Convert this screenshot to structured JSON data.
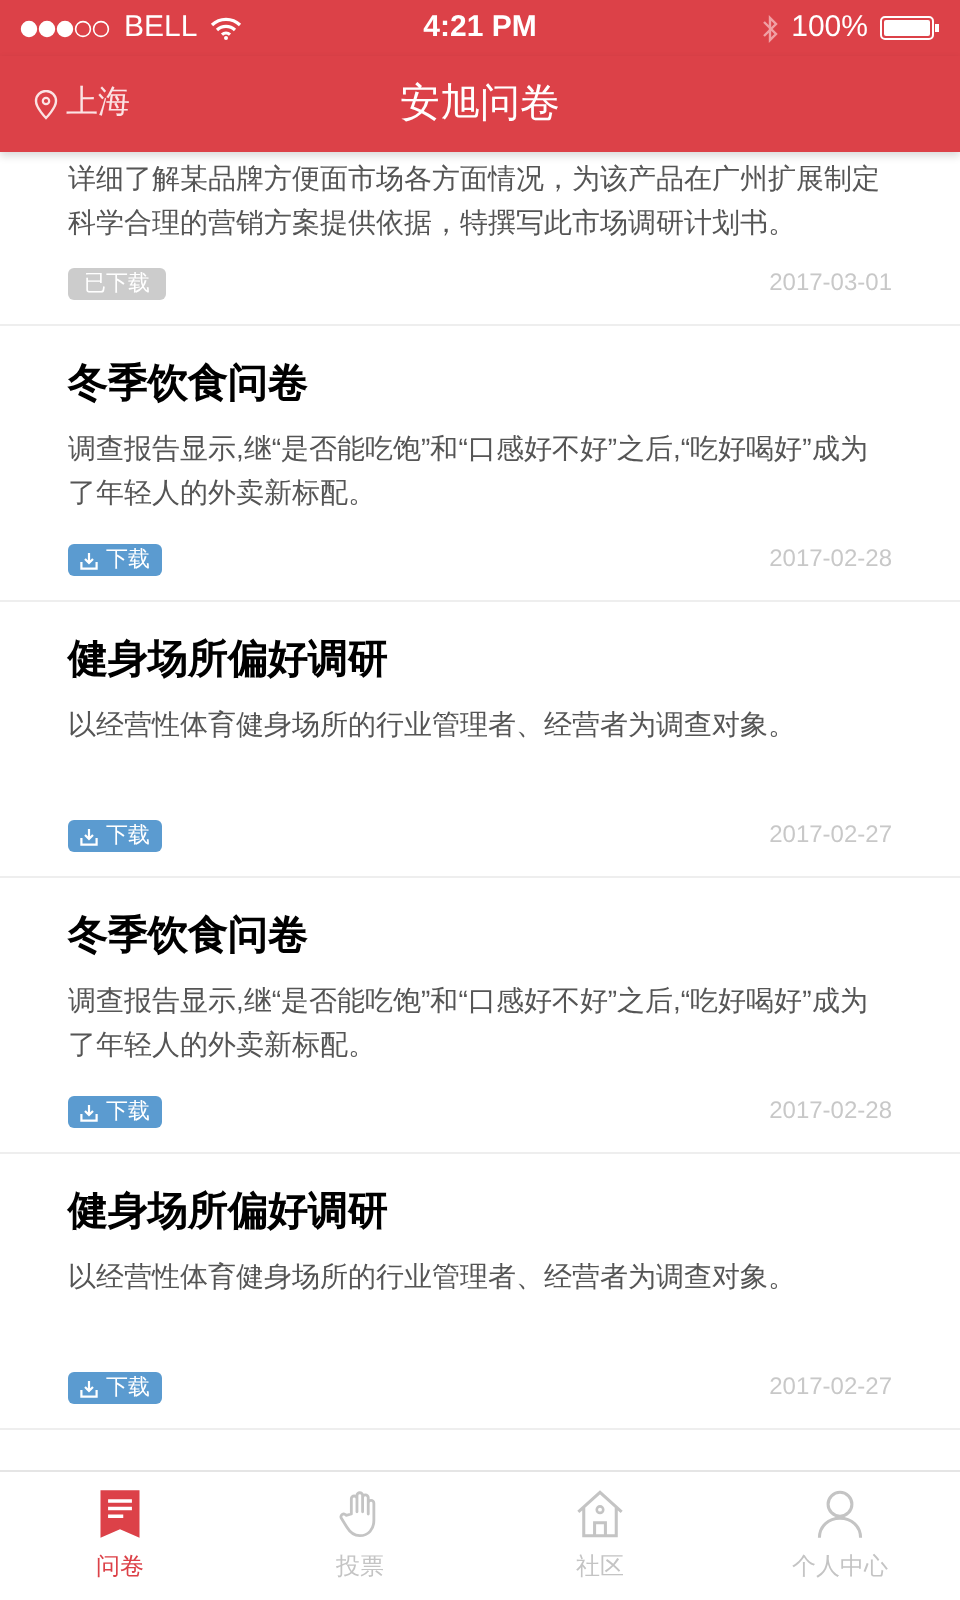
{
  "status_bar": {
    "carrier": "BELL",
    "time": "4:21 PM",
    "battery": "100%"
  },
  "header": {
    "location": "上海",
    "title": "安旭问卷"
  },
  "surveys": [
    {
      "description": "详细了解某品牌方便面市场各方面情况，为该产品在广州扩展制定科学合理的营销方案提供依据，特撰写此市场调研计划书。",
      "badge": "已下载",
      "downloaded": true,
      "date": "2017-03-01"
    },
    {
      "title": "冬季饮食问卷",
      "description": "调查报告显示,继“是否能吃饱”和“口感好不好”之后,“吃好喝好”成为了年轻人的外卖新标配。",
      "badge": "下载",
      "downloaded": false,
      "date": "2017-02-28"
    },
    {
      "title": "健身场所偏好调研",
      "description": "以经营性体育健身场所的行业管理者、经营者为调查对象。",
      "badge": "下载",
      "downloaded": false,
      "date": "2017-02-27"
    },
    {
      "title": "冬季饮食问卷",
      "description": "调查报告显示,继“是否能吃饱”和“口感好不好”之后,“吃好喝好”成为了年轻人的外卖新标配。",
      "badge": "下载",
      "downloaded": false,
      "date": "2017-02-28"
    },
    {
      "title": "健身场所偏好调研",
      "description": "以经营性体育健身场所的行业管理者、经营者为调查对象。",
      "badge": "下载",
      "downloaded": false,
      "date": "2017-02-27"
    }
  ],
  "tabs": [
    {
      "label": "问卷",
      "kind": "survey",
      "selected": true
    },
    {
      "label": "投票",
      "kind": "vote",
      "selected": false
    },
    {
      "label": "社区",
      "kind": "community",
      "selected": false
    },
    {
      "label": "个人中心",
      "kind": "profile",
      "selected": false
    }
  ]
}
